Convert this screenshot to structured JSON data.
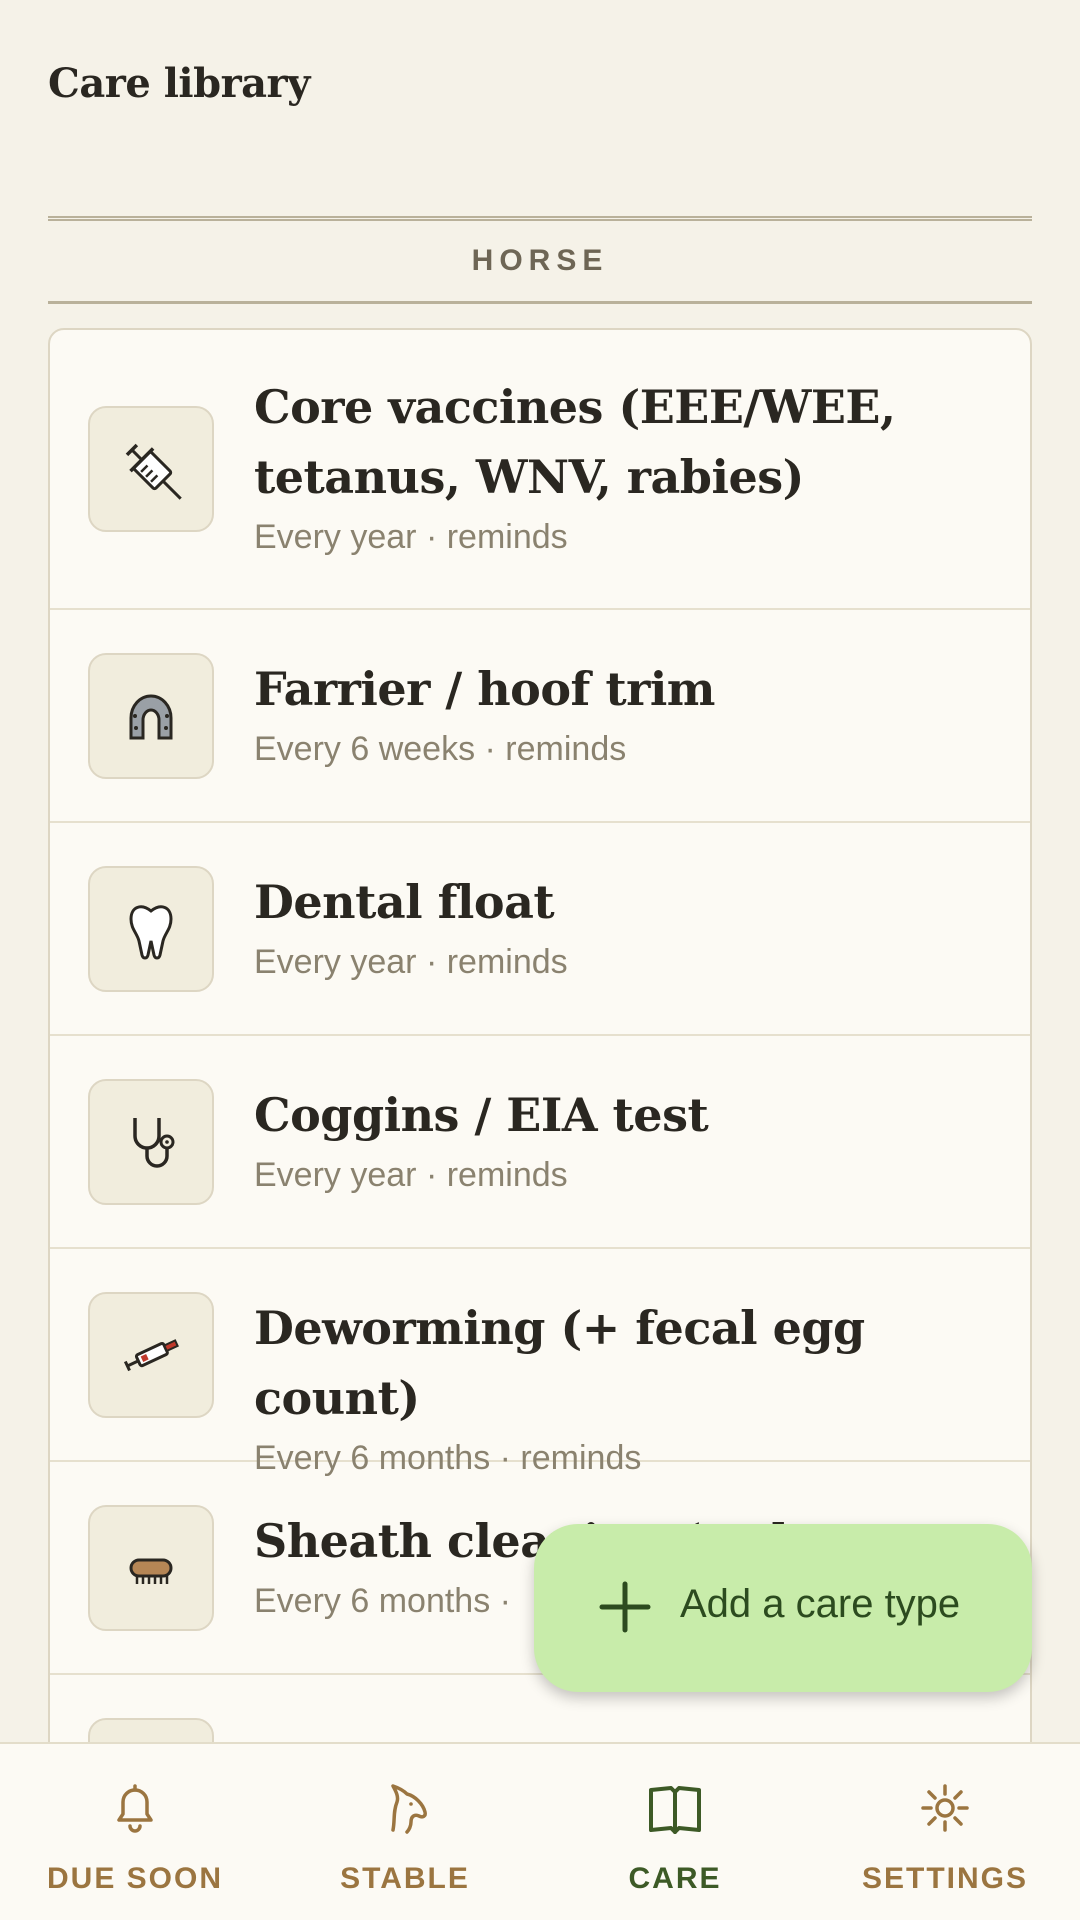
{
  "header": {
    "title": "Care library"
  },
  "section": {
    "label": "HORSE"
  },
  "care_items": [
    {
      "title": "Core vaccines (EEE/WEE, tetanus, WNV, rabies)",
      "subtitle": "Every year · reminds",
      "icon": "syringe-icon"
    },
    {
      "title": "Farrier / hoof trim",
      "subtitle": "Every 6 weeks · reminds",
      "icon": "horseshoe-icon"
    },
    {
      "title": "Dental float",
      "subtitle": "Every year · reminds",
      "icon": "tooth-icon"
    },
    {
      "title": "Coggins / EIA test",
      "subtitle": "Every year · reminds",
      "icon": "stethoscope-icon"
    },
    {
      "title": "Deworming (+ fecal egg count)",
      "subtitle": "Every 6 months · reminds",
      "icon": "dewormer-syringe-icon"
    },
    {
      "title": "Sheath cleaning (as l",
      "subtitle": "Every 6 months ·",
      "icon": "brush-icon"
    },
    {
      "title": "",
      "subtitle": "",
      "icon": "partial-icon"
    }
  ],
  "fab": {
    "label": "Add a care type",
    "icon": "plus-icon"
  },
  "nav": [
    {
      "label": "DUE SOON",
      "icon": "bell-icon",
      "active": false
    },
    {
      "label": "STABLE",
      "icon": "horse-head-icon",
      "active": false
    },
    {
      "label": "CARE",
      "icon": "book-icon",
      "active": true
    },
    {
      "label": "SETTINGS",
      "icon": "gear-icon",
      "active": false
    }
  ],
  "colors": {
    "background": "#f5f2e8",
    "fab": "#c8ecaa",
    "nav_inactive": "#9b7540",
    "nav_active": "#3d5a26"
  }
}
